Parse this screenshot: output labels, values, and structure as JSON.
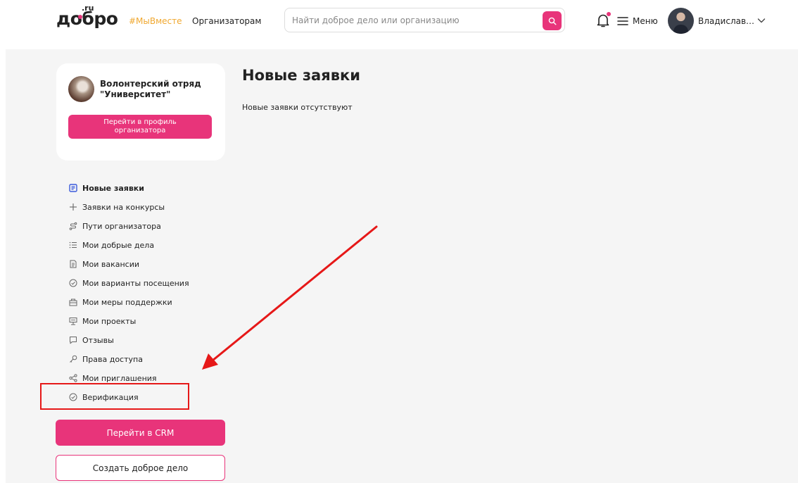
{
  "header": {
    "logo": "добро",
    "logo_sup": ".ru",
    "hashtag": "#МыВместе",
    "organizers_link": "Организаторам",
    "search_placeholder": "Найти доброе дело или организацию",
    "menu_label": "Меню",
    "user_name": "Владислав Мунасыпов"
  },
  "org_card": {
    "name": "Волонтерский отряд \"Университет\"",
    "profile_button": "Перейти в профиль организатора"
  },
  "sidebar": {
    "items": [
      {
        "label": "Новые заявки",
        "icon": "list-doc-icon",
        "active": true
      },
      {
        "label": "Заявки на конкурсы",
        "icon": "plus-icon",
        "active": false
      },
      {
        "label": "Пути организатора",
        "icon": "path-icon",
        "active": false
      },
      {
        "label": "Мои добрые дела",
        "icon": "list-icon",
        "active": false
      },
      {
        "label": "Мои вакансии",
        "icon": "document-icon",
        "active": false
      },
      {
        "label": "Мои варианты посещения",
        "icon": "check-circle-icon",
        "active": false
      },
      {
        "label": "Мои меры поддержки",
        "icon": "box-icon",
        "active": false
      },
      {
        "label": "Мои проекты",
        "icon": "presentation-icon",
        "active": false
      },
      {
        "label": "Отзывы",
        "icon": "comment-icon",
        "active": false
      },
      {
        "label": "Права доступа",
        "icon": "key-icon",
        "active": false
      },
      {
        "label": "Мои приглашения",
        "icon": "share-icon",
        "active": false
      },
      {
        "label": "Верификация",
        "icon": "check-circle-icon",
        "active": false
      }
    ],
    "crm_button": "Перейти в CRM",
    "create_button": "Создать доброе дело"
  },
  "main": {
    "title": "Новые заявки",
    "empty_text": "Новые заявки отсутствуют"
  },
  "colors": {
    "accent": "#e8347a",
    "hashtag": "#f0a830",
    "annotation": "#e61818",
    "background": "#f5f5f5"
  }
}
